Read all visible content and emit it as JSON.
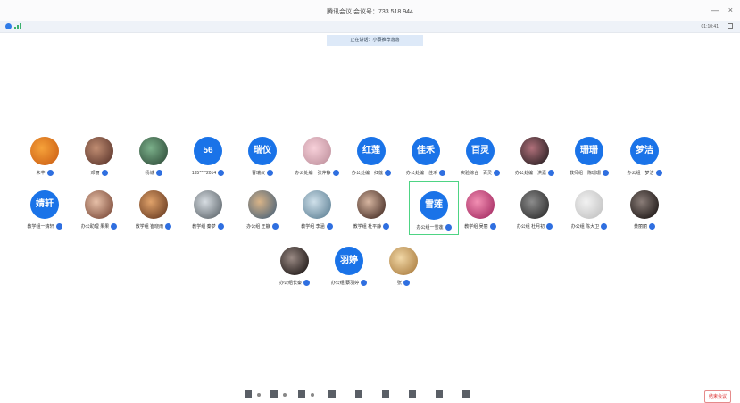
{
  "window": {
    "title": "腾讯会议 会议号：733 518 944",
    "minimize_glyph": "—",
    "close_glyph": "×"
  },
  "infobar": {
    "duration": "01:10:41"
  },
  "notice": {
    "text": "正在讲话：小蔡推荐落落"
  },
  "participants": [
    {
      "name": "朱芊",
      "avatar_text": "",
      "c1": "#f6a23a",
      "c2": "#d36a1a"
    },
    {
      "name": "邓丽",
      "avatar_text": "",
      "c1": "#c08d72",
      "c2": "#6a4236"
    },
    {
      "name": "杨城",
      "avatar_text": "",
      "c1": "#7bb08a",
      "c2": "#3b5c46"
    },
    {
      "name": "135****2014",
      "avatar_text": "56"
    },
    {
      "name": "曹瑞仪",
      "avatar_text": "瑞仪"
    },
    {
      "name": "办公处编一张萍静",
      "avatar_text": "",
      "c1": "#f7d0d9",
      "c2": "#c79aa6"
    },
    {
      "name": "办公处编一红莲",
      "avatar_text": "红莲"
    },
    {
      "name": "办公处编一佳禾",
      "avatar_text": "佳禾"
    },
    {
      "name": "实验综合一百灵",
      "avatar_text": "百灵"
    },
    {
      "name": "办公处编一洪嘉",
      "avatar_text": "",
      "c1": "#b0707a",
      "c2": "#3b2a2e"
    },
    {
      "name": "教师组一陈珊珊",
      "avatar_text": "珊珊"
    },
    {
      "name": "办公组一梦洁",
      "avatar_text": "梦洁"
    },
    {
      "name": "教学组一婧轩",
      "avatar_text": "婧轩"
    },
    {
      "name": "办公助理 果果",
      "avatar_text": "",
      "c1": "#e7c0a8",
      "c2": "#8a5a48"
    },
    {
      "name": "教学组 崔晓雨",
      "avatar_text": "",
      "c1": "#e0a26a",
      "c2": "#7a4a2c"
    },
    {
      "name": "教学组 秦梦",
      "avatar_text": "",
      "c1": "#d7dde2",
      "c2": "#6f777d"
    },
    {
      "name": "办公组 王静",
      "avatar_text": "",
      "c1": "#d9b488",
      "c2": "#5f6e7a"
    },
    {
      "name": "教学组 李涵",
      "avatar_text": "",
      "c1": "#cfe0ea",
      "c2": "#6f8fa2"
    },
    {
      "name": "教学组 杜平静",
      "avatar_text": "",
      "c1": "#d6b5a0",
      "c2": "#5a4036"
    },
    {
      "name": "办公组一雪莲",
      "avatar_text": "雪莲"
    },
    {
      "name": "教学组 吴丽",
      "avatar_text": "",
      "c1": "#f28fb3",
      "c2": "#b03a6e"
    },
    {
      "name": "办公组 杜月初",
      "avatar_text": "",
      "c1": "#8c8c8c",
      "c2": "#3a3a3a"
    },
    {
      "name": "办公组 陈大卫",
      "avatar_text": "",
      "c1": "#f2f2f2",
      "c2": "#c8c8c8"
    },
    {
      "name": "黄丽丽",
      "avatar_text": "",
      "c1": "#8a7d78",
      "c2": "#2b2422"
    },
    {
      "name": "办公组长秦",
      "avatar_text": "",
      "c1": "#9a8a84",
      "c2": "#2e2624"
    },
    {
      "name": "办公组 蔡羽婷",
      "avatar_text": "羽婷"
    },
    {
      "name": "张",
      "avatar_text": "",
      "c1": "#f1d7a6",
      "c2": "#b58a4e"
    }
  ],
  "selected_index": 19,
  "toolbar": {
    "end_label": "结束会议"
  },
  "colors": {
    "avatar_blue": "#1a73e8",
    "selected_border": "#4ed484",
    "mic": "#2f6fe0",
    "end": "#d33"
  }
}
